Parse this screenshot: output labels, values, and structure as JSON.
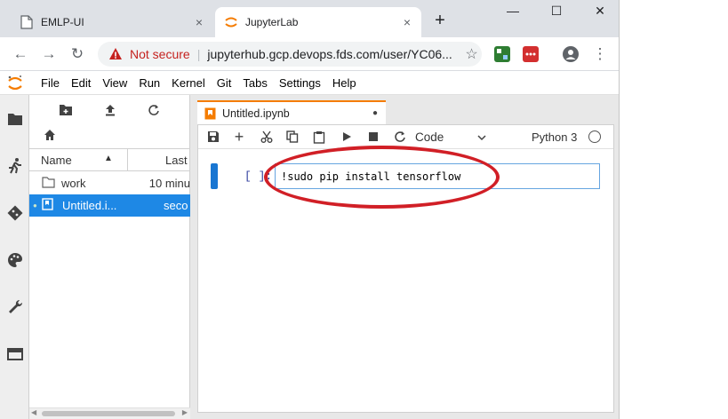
{
  "browser": {
    "tabs": [
      {
        "title": "EMLP-UI",
        "close": "×"
      },
      {
        "title": "JupyterLab",
        "close": "×"
      }
    ],
    "new_tab": "+",
    "window_controls": {
      "minimize": "—",
      "maximize": "☐",
      "close": "✕"
    },
    "nav": {
      "back": "←",
      "forward": "→",
      "reload": "↻"
    },
    "address": {
      "security_label": "Not secure",
      "separator": "|",
      "url": "jupyterhub.gcp.devops.fds.com/user/YC06...",
      "star": "☆"
    },
    "menu": "⋮"
  },
  "jupyter": {
    "menubar": [
      "File",
      "Edit",
      "View",
      "Run",
      "Kernel",
      "Git",
      "Tabs",
      "Settings",
      "Help"
    ],
    "file_browser": {
      "columns": {
        "name": "Name",
        "sort_arrow": "▲",
        "modified": "Last"
      },
      "rows": [
        {
          "name": "work",
          "modified": "10 minu"
        },
        {
          "name": "Untitled.i...",
          "modified": "seco"
        }
      ],
      "scroll_left": "◀",
      "scroll_right": "▶"
    },
    "doc_tab": {
      "title": "Untitled.ipynb"
    },
    "notebook_toolbar": {
      "cell_type": "Code",
      "kernel": "Python 3"
    },
    "cell": {
      "prompt": "[ ]:",
      "source": "!sudo pip install tensorflow"
    }
  },
  "colors": {
    "accent_orange": "#f57c00",
    "jupyter_blue": "#1976d2",
    "annotation_red": "#d11f26",
    "not_secure_red": "#c5221f"
  }
}
